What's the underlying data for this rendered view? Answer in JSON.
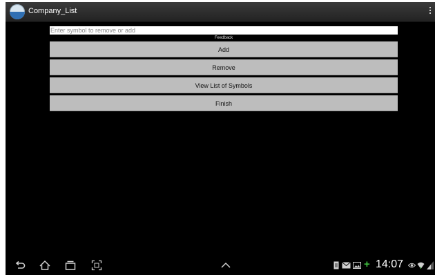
{
  "app": {
    "title": "Company_List"
  },
  "form": {
    "symbol_placeholder": "Enter symbol to remove or add",
    "symbol_value": "",
    "feedback_label": "Feedback"
  },
  "buttons": {
    "add": "Add",
    "remove": "Remove",
    "view_list": "View List of Symbols",
    "finish": "Finish"
  },
  "status_bar": {
    "time": "14:07"
  },
  "icons": {
    "app": "app-logo-icon",
    "overflow": "overflow-menu-icon",
    "back": "back-icon",
    "home": "home-icon",
    "recents": "recent-apps-icon",
    "screenshot": "screenshot-icon",
    "up": "chevron-up-icon"
  },
  "colors": {
    "background": "#000000",
    "button": "#bdbdbd",
    "input": "#ffffff",
    "accent_green": "#3fbf3f"
  }
}
